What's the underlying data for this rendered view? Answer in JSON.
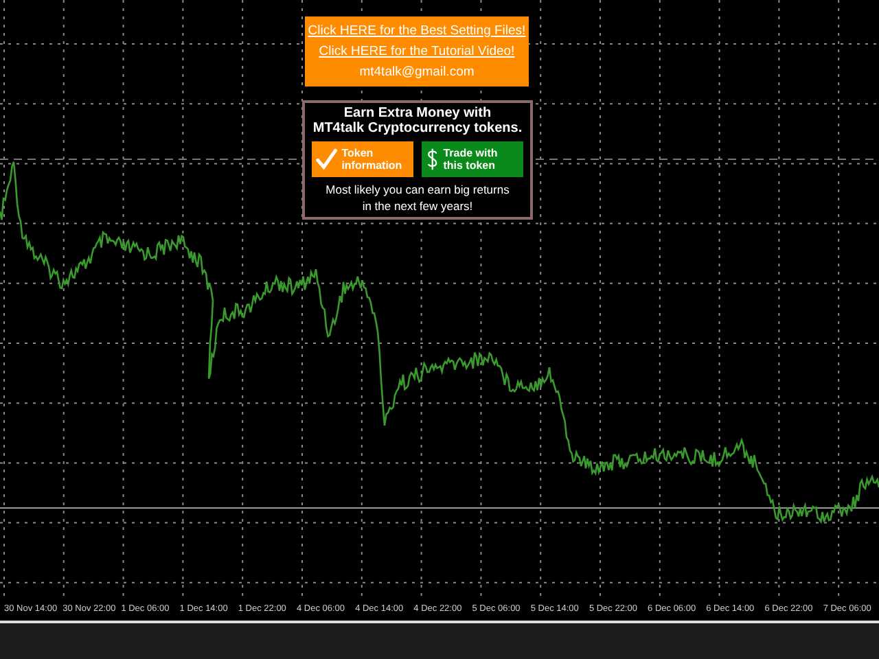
{
  "banner": {
    "links": [
      "Click HERE for the Best Setting Files!",
      "Click HERE for the Tutorial Video!"
    ],
    "email": "mt4talk@gmail.com"
  },
  "promo": {
    "title": [
      "Earn Extra Money with",
      "MT4talk Cryptocurrency tokens."
    ],
    "buttons": [
      {
        "kind": "check",
        "label": "Token information"
      },
      {
        "kind": "dollar",
        "label": "Trade with this token"
      }
    ],
    "footer": [
      "Most likely you can earn big returns",
      "in the next few years!"
    ]
  },
  "axis_labels": [
    "30 Nov 14:00",
    "30 Nov 22:00",
    "1 Dec 06:00",
    "1 Dec 14:00",
    "1 Dec 22:00",
    "4 Dec 06:00",
    "4 Dec 14:00",
    "4 Dec 22:00",
    "5 Dec 06:00",
    "5 Dec 14:00",
    "5 Dec 22:00",
    "6 Dec 06:00",
    "6 Dec 14:00",
    "6 Dec 22:00",
    "7 Dec 06:00"
  ]
}
